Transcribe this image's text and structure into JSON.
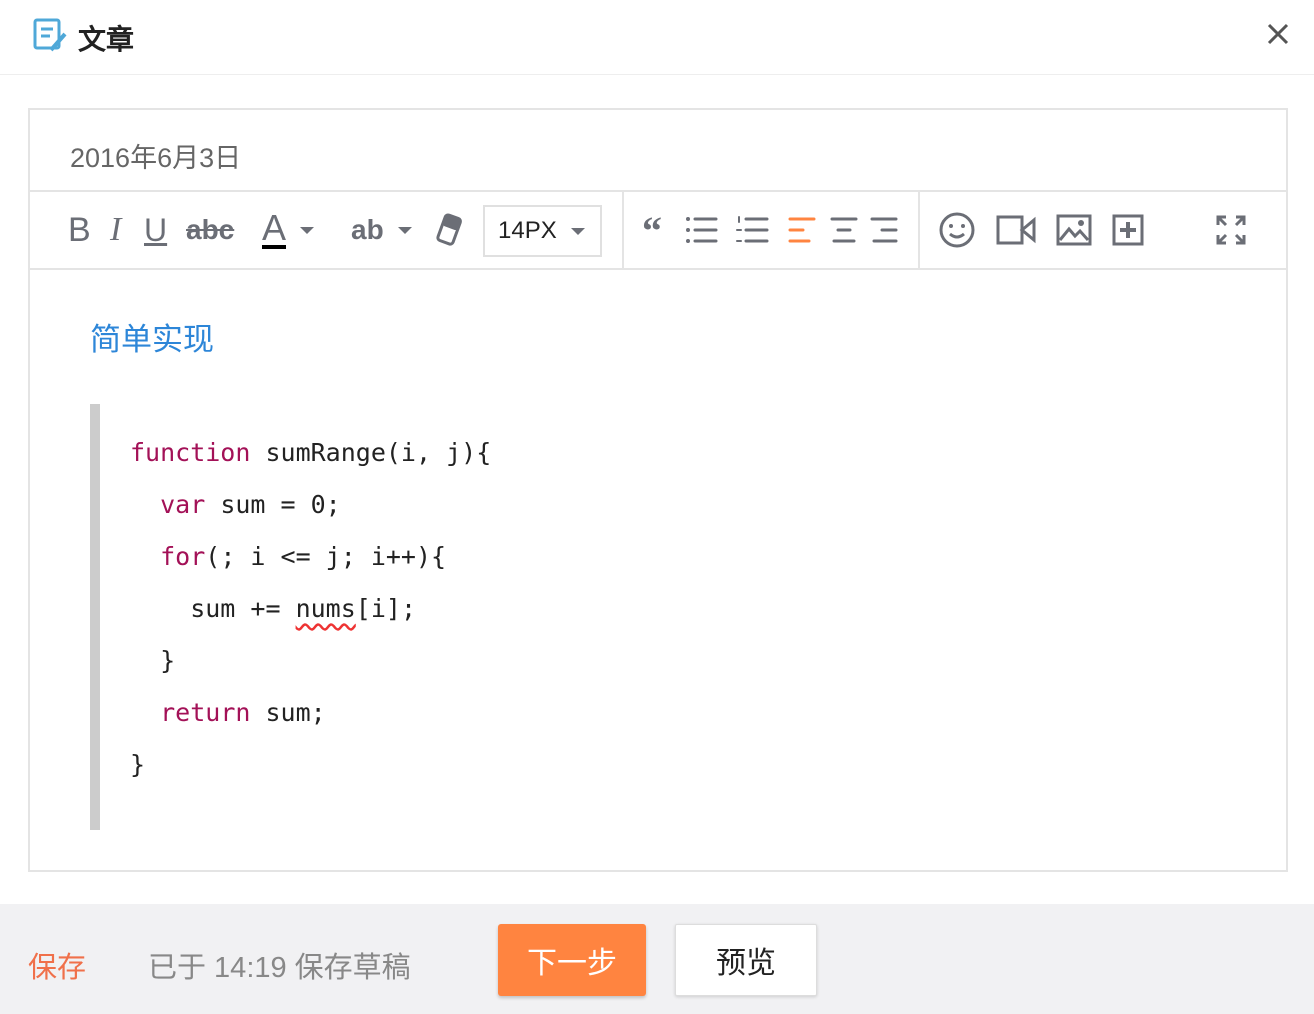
{
  "header": {
    "title": "文章",
    "icon": "edit-document-icon"
  },
  "editor": {
    "date": "2016年6月3日",
    "toolbar": {
      "bold": "B",
      "italic": "I",
      "underline": "U",
      "strike": "abc",
      "font_color": "A",
      "highlight": "ab",
      "font_size": "14PX"
    },
    "heading": "简单实现",
    "code_lines": [
      [
        {
          "t": "function",
          "kw": true
        },
        {
          "t": " sumRange(i, j){"
        }
      ],
      [
        {
          "t": "  "
        },
        {
          "t": "var",
          "kw": true
        },
        {
          "t": " sum = 0;"
        }
      ],
      [
        {
          "t": "  "
        },
        {
          "t": "for",
          "kw": true
        },
        {
          "t": "(; i <= j; i++){"
        }
      ],
      [
        {
          "t": "    sum += "
        },
        {
          "t": "nums",
          "sq": true
        },
        {
          "t": "[i];"
        }
      ],
      [
        {
          "t": "  }"
        }
      ],
      [
        {
          "t": "  "
        },
        {
          "t": "return",
          "kw": true
        },
        {
          "t": " sum;"
        }
      ],
      [
        {
          "t": "}"
        }
      ]
    ]
  },
  "footer": {
    "save": "保存",
    "status": "已于 14:19 保存草稿",
    "next": "下一步",
    "preview": "预览"
  },
  "colors": {
    "accent": "#ff8440",
    "link": "#2d86d8",
    "keyword": "#a31157",
    "save": "#f0704a"
  }
}
